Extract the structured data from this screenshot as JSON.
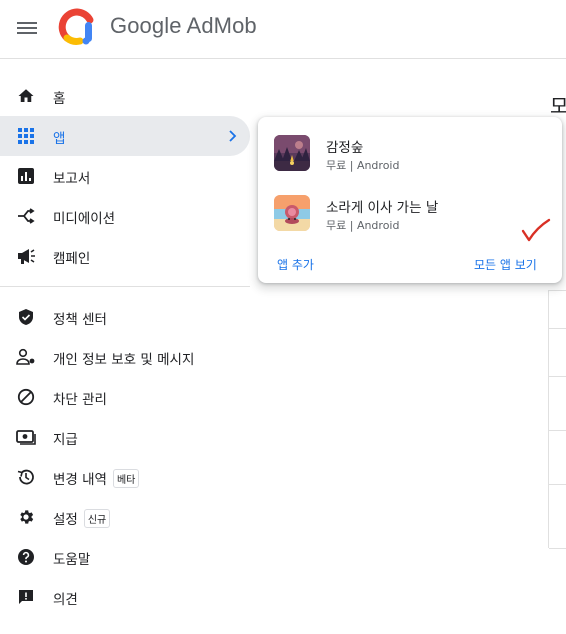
{
  "app": {
    "brand_google": "Google",
    "brand_product": "AdMob"
  },
  "colors": {
    "accent": "#1a73e8",
    "active_bg": "#e8eaed",
    "annotation": "#d93025"
  },
  "sidebar": {
    "items": [
      {
        "label": "홈",
        "icon": "home-icon"
      },
      {
        "label": "앱",
        "icon": "apps-grid-icon",
        "active": true
      },
      {
        "label": "보고서",
        "icon": "reports-icon"
      },
      {
        "label": "미디에이션",
        "icon": "mediation-icon"
      },
      {
        "label": "캠페인",
        "icon": "campaign-icon"
      },
      {
        "label": "정책 센터",
        "icon": "policy-shield-icon"
      },
      {
        "label": "개인 정보 보호 및 메시지",
        "icon": "privacy-icon"
      },
      {
        "label": "차단 관리",
        "icon": "block-icon"
      },
      {
        "label": "지급",
        "icon": "payments-icon"
      },
      {
        "label": "변경 내역",
        "icon": "history-icon",
        "badge": "베타"
      },
      {
        "label": "설정",
        "icon": "settings-gear-icon",
        "badge": "신규"
      },
      {
        "label": "도움말",
        "icon": "help-icon"
      },
      {
        "label": "의견",
        "icon": "feedback-icon"
      }
    ]
  },
  "popup": {
    "apps": [
      {
        "name": "감정숲",
        "meta": "무료 | Android"
      },
      {
        "name": "소라게 이사 가는 날",
        "meta": "무료 | Android"
      }
    ],
    "add_app": "앱 추가",
    "view_all": "모든 앱 보기"
  },
  "background": {
    "heading_fragment": "모"
  }
}
